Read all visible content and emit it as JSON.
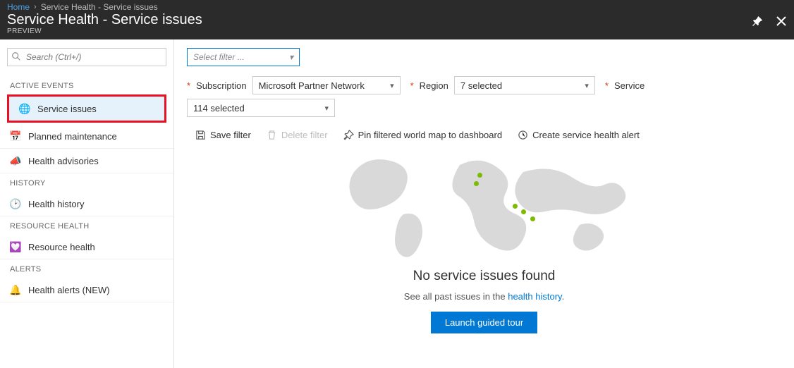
{
  "breadcrumb": {
    "home": "Home",
    "current": "Service Health - Service issues"
  },
  "page": {
    "title": "Service Health - Service issues",
    "subtitle": "PREVIEW"
  },
  "search": {
    "placeholder": "Search (Ctrl+/)"
  },
  "sidebar": {
    "sections": {
      "active": "ACTIVE EVENTS",
      "history": "HISTORY",
      "resource": "RESOURCE HEALTH",
      "alerts": "ALERTS"
    },
    "items": {
      "service_issues": "Service issues",
      "planned_maintenance": "Planned maintenance",
      "health_advisories": "Health advisories",
      "health_history": "Health history",
      "resource_health": "Resource health",
      "health_alerts": "Health alerts (NEW)"
    }
  },
  "filters": {
    "select_filter_placeholder": "Select filter ...",
    "subscription_label": "Subscription",
    "subscription_value": "Microsoft Partner Network",
    "region_label": "Region",
    "region_value": "7 selected",
    "service_label": "Service",
    "service_value": "114 selected"
  },
  "toolbar": {
    "save_filter": "Save filter",
    "delete_filter": "Delete filter",
    "pin_map": "Pin filtered world map to dashboard",
    "create_alert": "Create service health alert"
  },
  "empty": {
    "title": "No service issues found",
    "sub_prefix": "See all past issues in the ",
    "sub_link": "health history",
    "sub_suffix": ".",
    "cta": "Launch guided tour"
  }
}
